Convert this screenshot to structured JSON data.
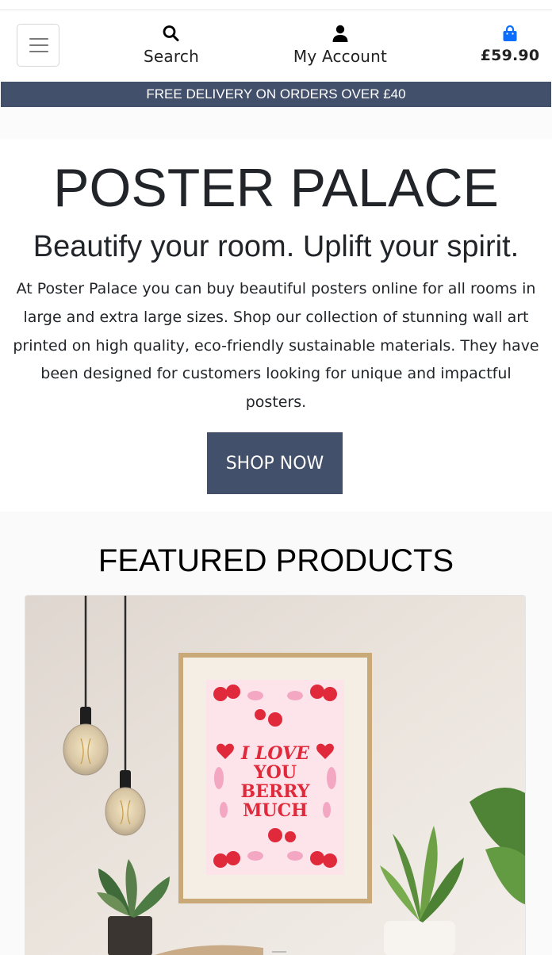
{
  "header": {
    "menu_icon": "hamburger-menu-icon",
    "search": {
      "label": "Search",
      "icon": "search-icon"
    },
    "account": {
      "label": "My Account",
      "icon": "user-icon"
    },
    "cart": {
      "total": "£59.90",
      "icon": "shopping-bag-icon"
    }
  },
  "promo": {
    "text": "FREE DELIVERY ON ORDERS OVER £40"
  },
  "hero": {
    "title": "POSTER PALACE",
    "subtitle": "Beautify your room. Uplift your spirit.",
    "body": "At Poster Palace you can buy beautiful posters online for all rooms in large and extra large sizes. Shop our collection of stunning wall art printed on high quality, eco-friendly sustainable materials. They have been designed for customers looking for unique and impactful posters.",
    "cta": "SHOP NOW"
  },
  "featured": {
    "title": "FEATURED PRODUCTS",
    "product": {
      "poster_text": [
        "I LOVE",
        "YOU",
        "BERRY",
        "MUCH"
      ]
    }
  },
  "colors": {
    "accent": "#43506b",
    "cart_icon": "#0d6efd",
    "poster_red": "#e0293b",
    "poster_pink": "#f6c9d6"
  }
}
